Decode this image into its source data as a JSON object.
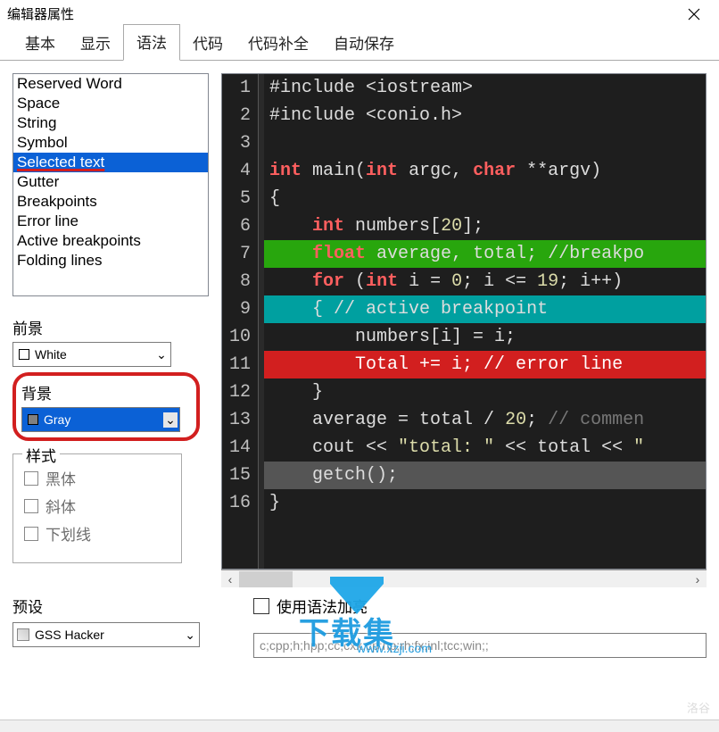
{
  "window": {
    "title": "编辑器属性"
  },
  "tabs": [
    {
      "label": "基本"
    },
    {
      "label": "显示"
    },
    {
      "label": "语法",
      "active": true
    },
    {
      "label": "代码"
    },
    {
      "label": "代码补全"
    },
    {
      "label": "自动保存"
    }
  ],
  "syntax_list": {
    "items": [
      "Reserved Word",
      "Space",
      "String",
      "Symbol",
      "Selected text",
      "Gutter",
      "Breakpoints",
      "Error line",
      "Active breakpoints",
      "Folding lines"
    ],
    "selected_index": 4
  },
  "foreground": {
    "label": "前景",
    "value": "White",
    "swatch": "#ffffff"
  },
  "background": {
    "label": "背景",
    "value": "Gray",
    "swatch": "#808080"
  },
  "style": {
    "legend": "样式",
    "bold": "黑体",
    "italic": "斜体",
    "underline": "下划线"
  },
  "code": {
    "lines": [
      {
        "n": 1,
        "cls": "",
        "html": "#include &lt;iostream&gt;"
      },
      {
        "n": 2,
        "cls": "",
        "html": "#include &lt;conio.h&gt;"
      },
      {
        "n": 3,
        "cls": "",
        "html": ""
      },
      {
        "n": 4,
        "cls": "",
        "html": "<span class='kw'>int</span> main(<span class='kw'>int</span> argc, <span class='kw'>char</span> **argv)"
      },
      {
        "n": 5,
        "cls": "",
        "html": "{"
      },
      {
        "n": 6,
        "cls": "",
        "html": "    <span class='kw'>int</span> numbers[<span class='num'>20</span>];"
      },
      {
        "n": 7,
        "cls": "bp-line",
        "html": "    <span class='kw'>float</span> average, total; //breakpo"
      },
      {
        "n": 8,
        "cls": "",
        "html": "    <span class='kw'>for</span> (<span class='kw'>int</span> i = <span class='num'>0</span>; i &lt;= <span class='num'>19</span>; i++)"
      },
      {
        "n": 9,
        "cls": "abp-line",
        "html": "    { // active breakpoint"
      },
      {
        "n": 10,
        "cls": "",
        "html": "        numbers[i] = i;"
      },
      {
        "n": 11,
        "cls": "err-line",
        "html": "        Total += i; // error line"
      },
      {
        "n": 12,
        "cls": "",
        "html": "    }"
      },
      {
        "n": 13,
        "cls": "",
        "html": "    average = total / <span class='num'>20</span>; <span class='comment'>// commen</span>"
      },
      {
        "n": 14,
        "cls": "",
        "html": "    cout &lt;&lt; <span class='str'>\"total: \"</span> &lt;&lt; total &lt;&lt; <span class='str'>\"</span>"
      },
      {
        "n": 15,
        "cls": "sel-line",
        "html": "    getch();"
      },
      {
        "n": 16,
        "cls": "",
        "html": "}"
      }
    ]
  },
  "use_syntax_highlight": {
    "label": "使用语法加亮"
  },
  "preset": {
    "label": "预设",
    "value": "GSS Hacker"
  },
  "extensions": {
    "placeholder": "c;cpp;h;hpp;cc;cxx;cp;hp;rh;fx;inl;tcc;win;;"
  },
  "watermark": {
    "brand": "下载集",
    "url": "www.xzji.com"
  },
  "corner": {
    "label": "洛谷"
  }
}
